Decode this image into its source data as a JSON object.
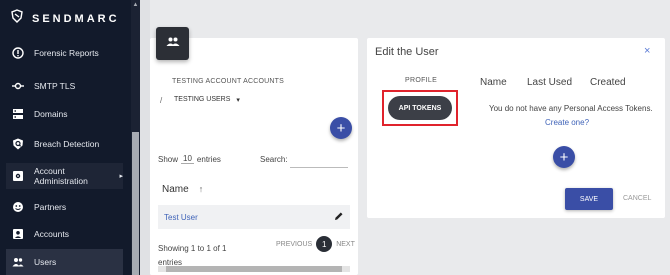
{
  "brand": {
    "name": "SENDMARC"
  },
  "sidebar": {
    "items": [
      {
        "label": "Forensic Reports",
        "icon": "alert-circle-icon"
      },
      {
        "label": "SMTP TLS",
        "icon": "key-icon"
      },
      {
        "label": "Domains",
        "icon": "server-icon"
      },
      {
        "label": "Breach Detection",
        "icon": "shield-search-icon"
      },
      {
        "label": "Account Administration",
        "icon": "admin-gear-icon",
        "arrow": "▸"
      },
      {
        "label": "Partners",
        "icon": "partners-icon"
      },
      {
        "label": "Accounts",
        "icon": "account-box-icon"
      },
      {
        "label": "Users",
        "icon": "users-icon"
      }
    ]
  },
  "left_panel": {
    "account_label": "TESTING ACCOUNT ACCOUNTS",
    "breadcrumb_sep": "/",
    "dropdown_label": "TESTING USERS",
    "dropdown_caret": "▾",
    "add_symbol": "+",
    "show_label": "Show",
    "entries_value": "10",
    "entries_label": "entries",
    "search_label": "Search:",
    "column_name": "Name",
    "sort_arrow": "↑",
    "rows": [
      {
        "name": "Test User"
      }
    ],
    "showing_line1": "Showing 1 to 1 of 1",
    "showing_line2": "entries",
    "pager": {
      "previous": "PREVIOUS",
      "page": "1",
      "next": "NEXT"
    }
  },
  "edit_dialog": {
    "title": "Edit the User",
    "close": "×",
    "profile_label": "PROFILE",
    "api_tokens_button": "API TOKENS",
    "columns": {
      "name": "Name",
      "last_used": "Last Used",
      "created": "Created"
    },
    "empty_message": "You do not have any Personal Access Tokens.",
    "create_link": "Create one?",
    "add_symbol": "+",
    "save_label": "SAVE",
    "cancel_label": "CANCEL"
  },
  "colors": {
    "sidebar_bg": "#121a2b",
    "accent": "#3a4ea6",
    "link": "#3f63b8",
    "highlight": "#e0232c"
  }
}
